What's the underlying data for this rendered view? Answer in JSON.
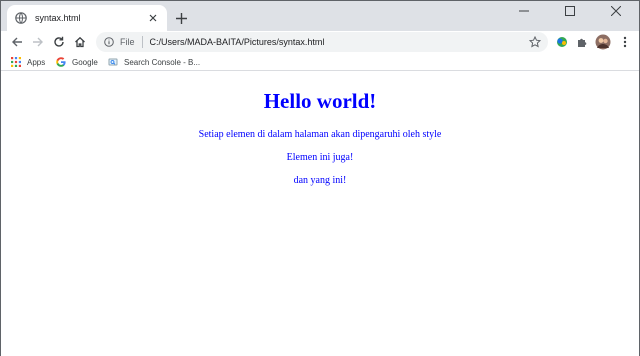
{
  "tab": {
    "title": "syntax.html"
  },
  "window_controls": {
    "minimize": "–",
    "maximize": "□",
    "close": "✕"
  },
  "omnibox": {
    "scheme": "File",
    "url": "C:/Users/MADA-BAITA/Pictures/syntax.html"
  },
  "bookmarks": [
    {
      "label": "Apps",
      "icon": "apps-grid-icon"
    },
    {
      "label": "Google",
      "icon": "google-icon"
    },
    {
      "label": "Search Console - B...",
      "icon": "search-console-icon"
    }
  ],
  "page": {
    "heading": "Hello world!",
    "paragraphs": [
      "Setiap elemen di dalam halaman akan dipengaruhi oleh style",
      "Elemen ini juga!",
      "dan yang ini!"
    ],
    "text_color": "#0000ff"
  }
}
